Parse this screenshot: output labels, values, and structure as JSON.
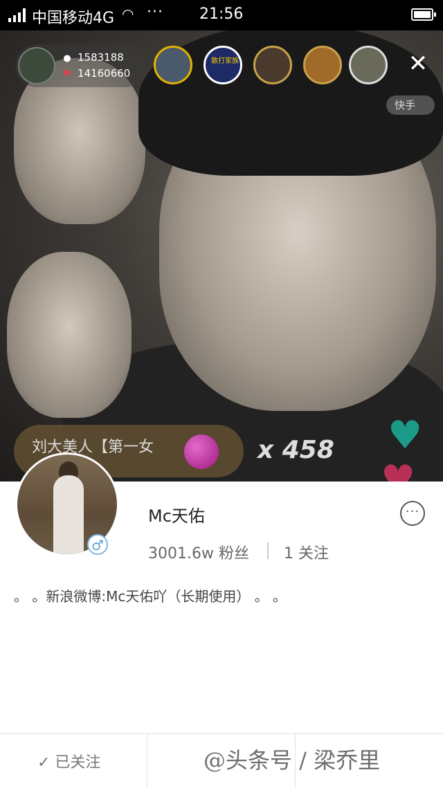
{
  "status_bar": {
    "carrier": "中国移动4G",
    "time": "21:56",
    "wifi_icon": "wifi-icon",
    "more_icon": "···"
  },
  "live": {
    "host_stats": {
      "viewers": "1583188",
      "likes": "14160660"
    },
    "viewers": [
      {
        "name": "viewer-avatar-1",
        "border": "#e0b400",
        "bg": "#4b5a6a",
        "label": ""
      },
      {
        "name": "viewer-avatar-2",
        "border": "#ffffff",
        "bg": "#1d2a66",
        "label": "散打家族"
      },
      {
        "name": "viewer-avatar-3",
        "border": "#c9a24a",
        "bg": "#4a3a2e",
        "label": ""
      },
      {
        "name": "viewer-avatar-4",
        "border": "#c9a24a",
        "bg": "#a06a2a",
        "label": ""
      },
      {
        "name": "viewer-avatar-5",
        "border": "#dddddd",
        "bg": "#6a6a5a",
        "label": ""
      }
    ],
    "tag": "快手",
    "gift": {
      "sender": "刘大美人【第一女",
      "combo": "x 458"
    }
  },
  "profile": {
    "username": "Mc天佑",
    "fans": "3001.6w 粉丝",
    "follows": "1 关注",
    "bio": "。 。新浪微博:Mc天佑吖（长期使用） 。 。",
    "gender_symbol": "♂"
  },
  "footer": {
    "followed_label": "✓ 已关注",
    "watermark": "@头条号 / 梁乔里"
  }
}
